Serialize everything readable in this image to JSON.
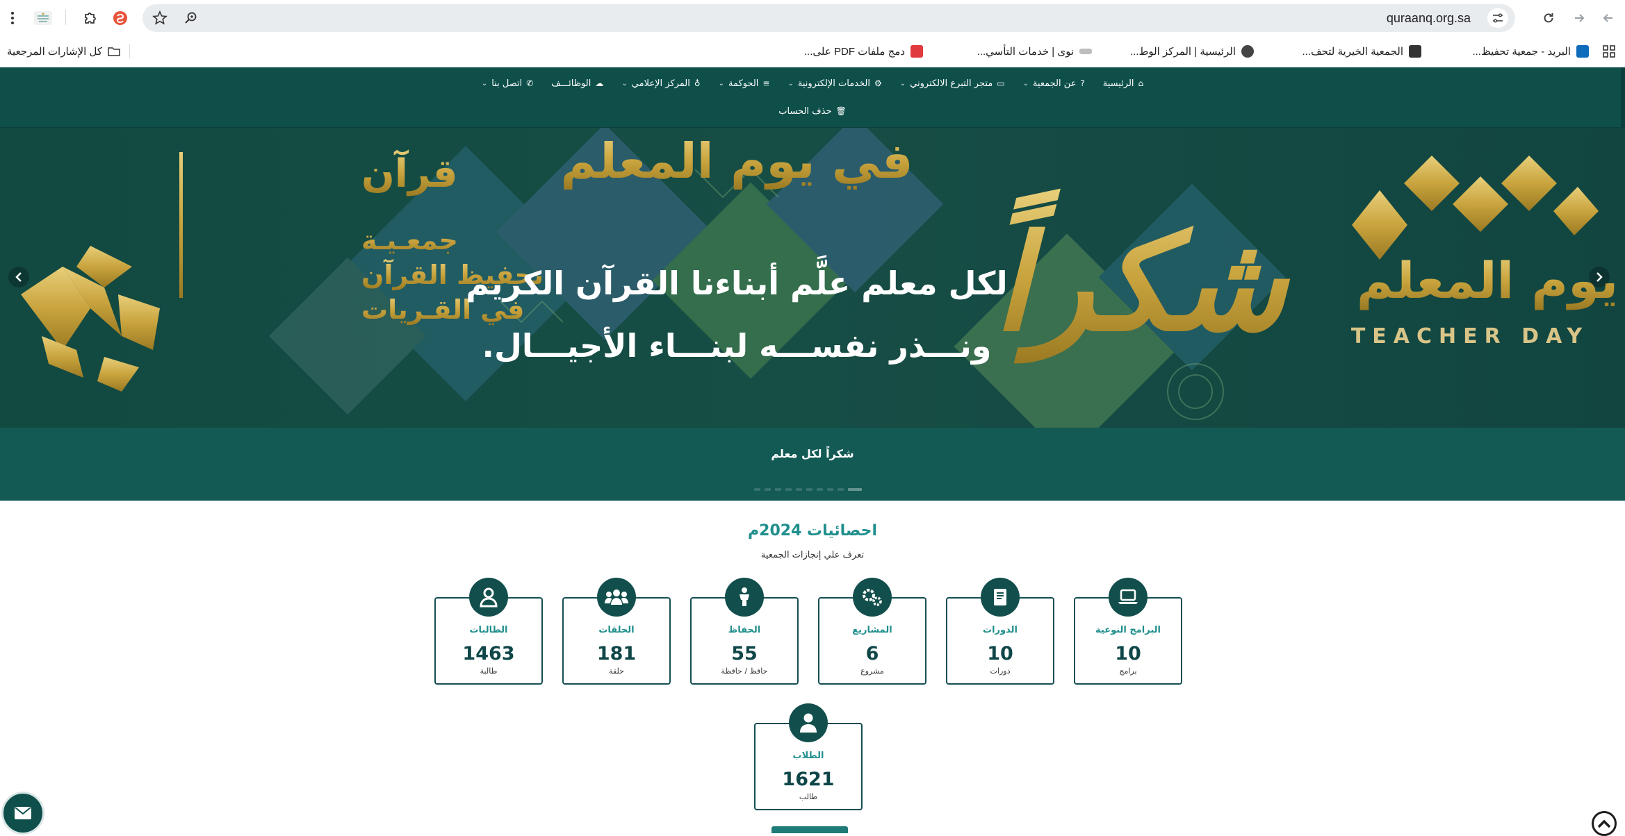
{
  "browser": {
    "url": "quraanq.org.sa",
    "icons": {
      "back": "back-arrow-icon",
      "forward": "forward-arrow-icon",
      "reload": "reload-icon",
      "site_settings": "tune-icon",
      "zoom": "zoom-icon",
      "bookmark_star": "star-icon",
      "extension_red": "swirl-extension-icon",
      "extensions": "puzzle-icon",
      "profile": "profile-logo-icon",
      "menu": "kebab-menu-icon",
      "apps": "apps-grid-icon"
    },
    "bookmarks": [
      {
        "label": "البريد - جمعية تحفيظ...",
        "icon": "outlook-icon",
        "color": "#0f6cbd"
      },
      {
        "label": "الجمعية الخيرية لتحف...",
        "icon": "r-logo-icon",
        "color": "#333333"
      },
      {
        "label": "الرئيسية | المركز الوط...",
        "icon": "globe-icon",
        "color": "#444444"
      },
      {
        "label": "نوى | خدمات التأسي...",
        "icon": "nawa-icon",
        "color": "#8a8a8a"
      },
      {
        "label": "دمج ملفات PDF على...",
        "icon": "heart-pdf-icon",
        "color": "#e0393e"
      }
    ],
    "all_bookmarks": "كل الإشارات المرجعية"
  },
  "nav": {
    "row1": [
      {
        "label": "الرئيسية",
        "icon": "home-icon",
        "dropdown": false
      },
      {
        "label": "عن الجمعية",
        "icon": "question-icon",
        "dropdown": true
      },
      {
        "label": "متجر التبرع الالكتروني",
        "icon": "card-icon",
        "dropdown": true
      },
      {
        "label": "الخدمات الإلكترونية",
        "icon": "cogs-icon",
        "dropdown": true
      },
      {
        "label": "الحوكمة",
        "icon": "list-icon",
        "dropdown": true
      },
      {
        "label": "المركز الإعلامي",
        "icon": "mic-icon",
        "dropdown": true
      },
      {
        "label": "الوظائـــف",
        "icon": "hands-icon",
        "dropdown": false
      },
      {
        "label": "اتصل بنا",
        "icon": "phone-icon",
        "dropdown": true
      }
    ],
    "row2": [
      {
        "label": "حذف الحساب",
        "icon": "trash-icon",
        "dropdown": false
      }
    ]
  },
  "hero": {
    "headline": "في يوم المعلم",
    "line1": "لكل معلم علَّم أبناءنا القرآن الكريم",
    "line2": "ونـــذر نفســـه لبنـــاء الأجيـــال.",
    "calligraphy": "شكراً",
    "teacher_day_ar": "يوم المعلم",
    "teacher_day_en": "TEACHER DAY",
    "logo_word": "قرآن",
    "logo_line1": "جمعـيـة",
    "logo_line2": "تحفيظ القرآن",
    "logo_line3": "في القـريات",
    "caption": "شكراً لكل معلم",
    "colors": {
      "background": "#13463f",
      "gold": "#c9a43e"
    },
    "slides_total": 10,
    "active_slide": 10
  },
  "stats": {
    "title": "احصائيات 2024م",
    "subtitle": "تعرف علي إنجازات الجمعية",
    "cards": [
      {
        "label": "البرامج النوعية",
        "value": "10",
        "unit": "برامج",
        "icon": "laptop-icon"
      },
      {
        "label": "الدورات",
        "value": "10",
        "unit": "دورات",
        "icon": "book-icon"
      },
      {
        "label": "المشاريع",
        "value": "6",
        "unit": "مشروع",
        "icon": "cogs-icon"
      },
      {
        "label": "الحفاظ",
        "value": "55",
        "unit": "حافظ / حافظة",
        "icon": "child-icon"
      },
      {
        "label": "الحلقات",
        "value": "181",
        "unit": "حلقة",
        "icon": "group-icon"
      },
      {
        "label": "الطالبات",
        "value": "1463",
        "unit": "طالبة",
        "icon": "user-icon"
      },
      {
        "label": "الطلاب",
        "value": "1621",
        "unit": "طالب",
        "icon": "user-icon"
      }
    ]
  },
  "widgets": {
    "mail": "mail-icon",
    "scroll_up": "chevron-up-icon"
  }
}
